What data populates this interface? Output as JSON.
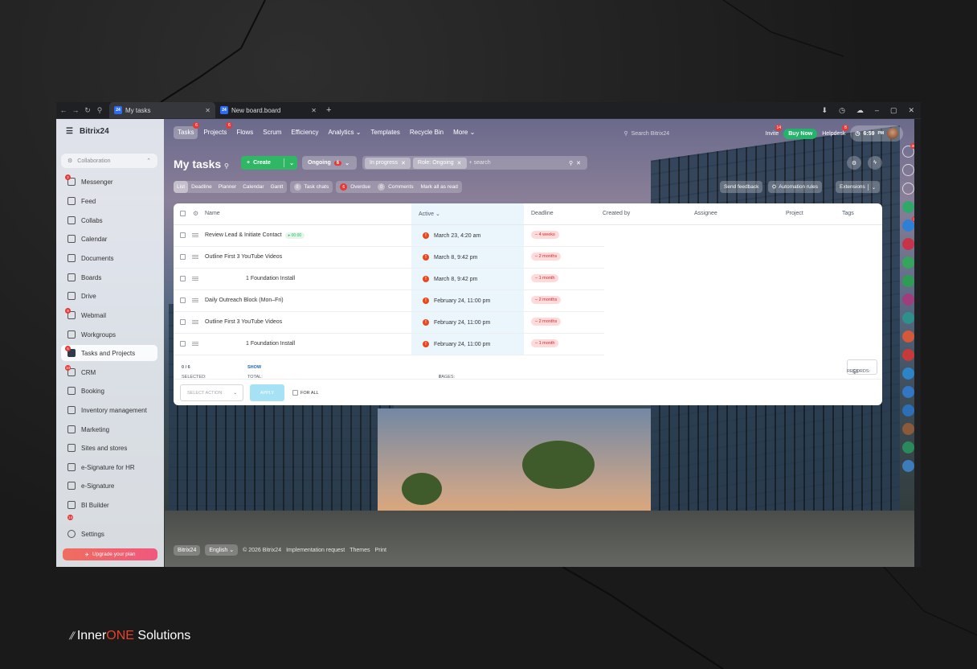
{
  "browser": {
    "tabs": [
      {
        "title": "My tasks",
        "favicon": "24"
      },
      {
        "title": "New board.board",
        "favicon": "24"
      }
    ]
  },
  "sidebar": {
    "logo": "Bitrix24",
    "group_label": "Collaboration",
    "items": [
      {
        "label": "Messenger",
        "icon": "chat-icon",
        "badge": "2"
      },
      {
        "label": "Feed",
        "icon": "feed-icon"
      },
      {
        "label": "Collabs",
        "icon": "collabs-icon"
      },
      {
        "label": "Calendar",
        "icon": "calendar-icon"
      },
      {
        "label": "Documents",
        "icon": "document-icon"
      },
      {
        "label": "Boards",
        "icon": "board-icon"
      },
      {
        "label": "Drive",
        "icon": "drive-icon"
      },
      {
        "label": "Webmail",
        "icon": "mail-icon",
        "badge": "9"
      },
      {
        "label": "Workgroups",
        "icon": "group-icon"
      },
      {
        "label": "Tasks and Projects",
        "icon": "tasks-icon",
        "badge": "6"
      },
      {
        "label": "CRM",
        "icon": "crm-icon",
        "badge": "10"
      },
      {
        "label": "Booking",
        "icon": "booking-icon"
      },
      {
        "label": "Inventory management",
        "icon": "inventory-icon"
      },
      {
        "label": "Marketing",
        "icon": "marketing-icon"
      },
      {
        "label": "Sites and stores",
        "icon": "cart-icon"
      },
      {
        "label": "e-Signature for HR",
        "icon": "signature-hr-icon"
      },
      {
        "label": "e-Signature",
        "icon": "signature-icon"
      },
      {
        "label": "BI Builder",
        "icon": "chart-icon"
      }
    ],
    "extra_badge": "14",
    "settings": "Settings",
    "upgrade": "Upgrade your plan"
  },
  "topnav": {
    "items": [
      {
        "label": "Tasks",
        "badge": "6"
      },
      {
        "label": "Projects",
        "badge": "6"
      },
      {
        "label": "Flows"
      },
      {
        "label": "Scrum"
      },
      {
        "label": "Efficiency"
      },
      {
        "label": "Analytics ⌄"
      },
      {
        "label": "Templates"
      },
      {
        "label": "Recycle Bin"
      },
      {
        "label": "More ⌄"
      }
    ],
    "search_text": "Search Bitrix24",
    "invite": "Invite",
    "invite_badge": "14",
    "buy_now": "Buy Now",
    "helpdesk": "Helpdesk",
    "helpdesk_badge": "8",
    "time": "6:59",
    "ampm": "PM"
  },
  "toolbar": {
    "title": "My tasks",
    "create": "Create",
    "filter": "Ongoing",
    "filter_count": "6",
    "chips": [
      "In progress",
      "Role: Ongoing"
    ],
    "search_placeholder": "+ search"
  },
  "views": {
    "modes": [
      "List",
      "Deadline",
      "Planner",
      "Calendar",
      "Gantt"
    ],
    "task_chats": "Task chats",
    "task_chats_count": "0",
    "overdue": "Overdue",
    "overdue_count": "6",
    "comments": "Comments",
    "comments_count": "0",
    "mark_read": "Mark all as read",
    "send_feedback": "Send feedback",
    "automation": "Automation rules",
    "extensions": "Extensions"
  },
  "table": {
    "columns": {
      "name": "Name",
      "active": "Active ⌄",
      "deadline": "Deadline",
      "created_by": "Created by",
      "assignee": "Assignee",
      "project": "Project",
      "tags": "Tags"
    },
    "rows": [
      {
        "name": "Review Lead & Initiate Contact",
        "timer": "▸ 00:00",
        "active": "March 23, 4:20 am",
        "deadline": "– 4 weeks"
      },
      {
        "name": "Outline First 3 YouTube Videos",
        "active": "March 8, 9:42 pm",
        "deadline": "– 2 months"
      },
      {
        "name": "1 Foundation Install",
        "active": "March 8, 9:42 pm",
        "deadline": "– 1 month"
      },
      {
        "name": "Daily Outreach Block (Mon–Fri)",
        "active": "February 24, 11:00 pm",
        "deadline": "– 2 months"
      },
      {
        "name": "Outline First 3 YouTube Videos",
        "active": "February 24, 11:00 pm",
        "deadline": "– 2 months"
      },
      {
        "name": "1 Foundation Install",
        "active": "February 24, 11:00 pm",
        "deadline": "– 1 month"
      }
    ],
    "selected_label": "SELECTED:",
    "selected_value": "0 / 6",
    "total_label": "TOTAL:",
    "total_value": "SHOW",
    "pages_label": "PAGES:",
    "pages_value": "1",
    "records_label": "RECORDS:",
    "records_value": "50",
    "select_action": "SELECT ACTION",
    "apply": "APPLY",
    "for_all": "FOR ALL"
  },
  "footer": {
    "brand": "Bitrix24",
    "language": "English",
    "copyright": "© 2026 Bitrix24",
    "implementation": "Implementation request",
    "themes": "Themes",
    "print": "Print"
  },
  "rightbar": {
    "notif_badge": "26",
    "phone_badge": "2"
  },
  "watermark": {
    "prefix": "Inner",
    "highlight": "ONE",
    "suffix": " Solutions"
  },
  "colors": {
    "accent_green": "#2fb766",
    "badge_red": "#e53935",
    "overdue": "#e8481c",
    "brand_red": "#e8402a"
  }
}
